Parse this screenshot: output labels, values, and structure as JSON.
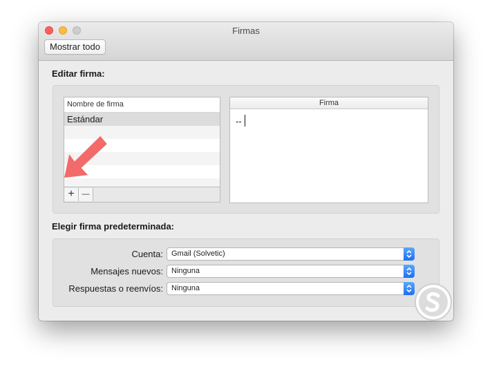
{
  "window": {
    "title": "Firmas"
  },
  "toolbar": {
    "show_all_label": "Mostrar todo"
  },
  "edit_section": {
    "title": "Editar firma:",
    "list": {
      "header": "Nombre de firma",
      "items": [
        "Estándar"
      ],
      "add_label": "+",
      "remove_label": "—"
    },
    "editor": {
      "header": "Firma",
      "content": "--"
    }
  },
  "default_section": {
    "title": "Elegir firma predeterminada:",
    "rows": [
      {
        "label": "Cuenta:",
        "value": "Gmail (Solvetic)"
      },
      {
        "label": "Mensajes nuevos:",
        "value": "Ninguna"
      },
      {
        "label": "Respuestas o reenvíos:",
        "value": "Ninguna"
      }
    ]
  },
  "colors": {
    "accent_blue": "#1f6ff2",
    "annotation_arrow": "#f26a6a",
    "close": "#fc615d",
    "minimize": "#fdbc40",
    "maximize_disabled": "#cdcdcd"
  }
}
